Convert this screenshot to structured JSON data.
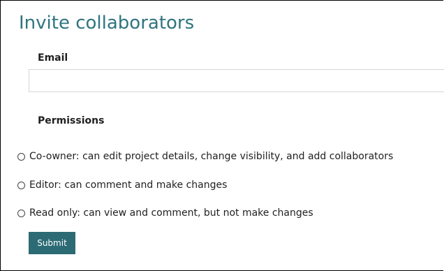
{
  "form": {
    "title": "Invite collaborators",
    "email_label": "Email",
    "email_value": "",
    "email_placeholder": "",
    "permissions_label": "Permissions",
    "options": [
      {
        "label": "Co-owner: can edit project details, change visibility, and add collaborators",
        "selected": false
      },
      {
        "label": "Editor: can comment and make changes",
        "selected": false
      },
      {
        "label": "Read only: can view and comment, but not make changes",
        "selected": false
      }
    ],
    "submit_label": "Submit"
  },
  "colors": {
    "title": "#2f7580",
    "submit_bg": "#2c6b74",
    "submit_text": "#ffffff",
    "input_border": "#d6d6d6"
  }
}
